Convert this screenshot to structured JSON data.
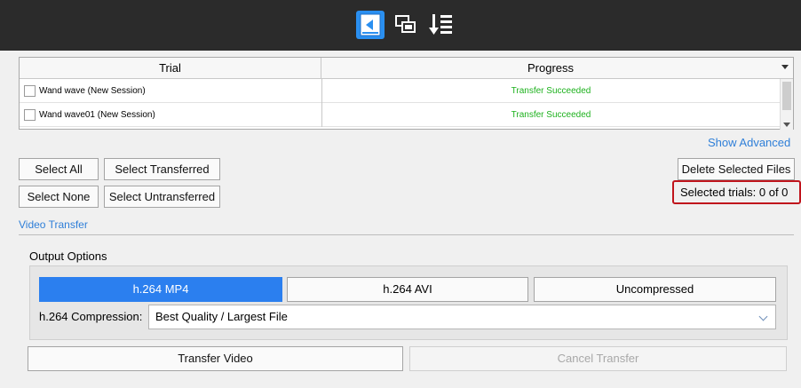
{
  "toolbar": {
    "icons": [
      "transfer-icon",
      "windows-icon",
      "sort-list-icon"
    ],
    "active_color": "#2a8ff0"
  },
  "table": {
    "columns": [
      "Trial",
      "Progress"
    ],
    "rows": [
      {
        "trial": "Wand wave (New Session)",
        "progress": "Transfer Succeeded"
      },
      {
        "trial": "Wand wave01 (New Session)",
        "progress": "Transfer Succeeded"
      }
    ],
    "success_color": "#1db11d"
  },
  "show_advanced": "Show Advanced",
  "selection": {
    "select_all": "Select All",
    "select_transferred": "Select Transferred",
    "select_none": "Select None",
    "select_untransferred": "Select Untransferred",
    "delete_files": "Delete Selected Files",
    "selected_count": "Selected trials:  0 of 0"
  },
  "video_transfer": {
    "section_label": "Video Transfer",
    "output_options_label": "Output Options",
    "formats": [
      "h.264 MP4",
      "h.264 AVI",
      "Uncompressed"
    ],
    "selected_format": "h.264 MP4",
    "compression_label": "h.264 Compression:",
    "compression_value": "Best Quality / Largest File",
    "transfer_button": "Transfer Video",
    "cancel_button": "Cancel Transfer",
    "accent_color": "#2b7fef",
    "highlight_color": "#c0141c"
  }
}
